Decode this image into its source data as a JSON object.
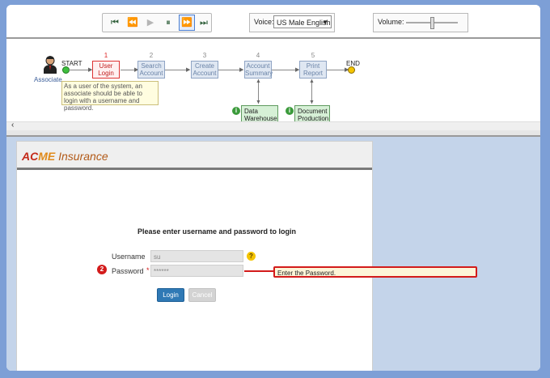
{
  "toolbar": {
    "controls": [
      "⏮",
      "⏪",
      "▶",
      "⏸",
      "⏩",
      "⏭"
    ],
    "voice_label": "Voice:",
    "voice_value": "US Male English",
    "volume_label": "Volume:",
    "volume_level": 0.5
  },
  "diagram": {
    "actor_label": "Associate",
    "start_label": "START",
    "end_label": "END",
    "steps": [
      {
        "num": "1",
        "label": "User Login"
      },
      {
        "num": "2",
        "label": "Search Account"
      },
      {
        "num": "3",
        "label": "Create Account"
      },
      {
        "num": "4",
        "label": "Account Summary"
      },
      {
        "num": "5",
        "label": "Print Report"
      }
    ],
    "datastores": [
      {
        "label": "Data Warehouse"
      },
      {
        "label": "Document Production"
      }
    ],
    "tooltip": "As a user of the system, an associate should be able to login with a username and password."
  },
  "app": {
    "brand": {
      "part1": "AC",
      "part2": "ME",
      "part3": " Insurance"
    },
    "heading": "Please enter username and password to login",
    "username_label": "Username",
    "username_value": "su",
    "password_label": "Password",
    "password_value": "******",
    "login_label": "Login",
    "cancel_label": "Cancel",
    "callout_step": "2",
    "callout_text": "Enter the Password."
  },
  "colors": {
    "accent": "#2f79b5",
    "callout_border": "#d31b1b",
    "frame": "#7d9fd6"
  }
}
